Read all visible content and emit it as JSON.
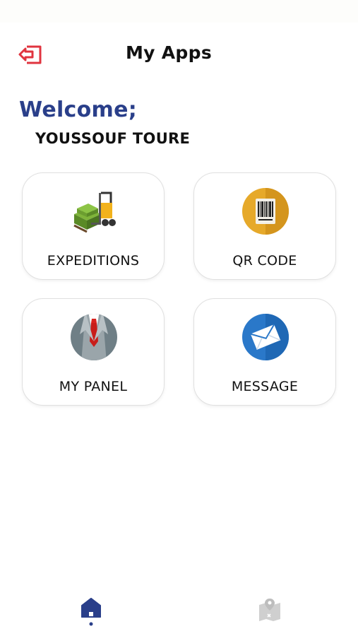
{
  "header": {
    "title": "My Apps",
    "logout_icon": "logout-icon",
    "logout_color": "#e0343f"
  },
  "greeting": {
    "welcome": "Welcome;",
    "user_name": "YOUSSOUF TOURE",
    "welcome_color": "#2a3f8a"
  },
  "apps": [
    {
      "label": "EXPEDITIONS",
      "icon": "forklift-icon"
    },
    {
      "label": "QR CODE",
      "icon": "barcode-icon"
    },
    {
      "label": "MY PANEL",
      "icon": "suit-icon"
    },
    {
      "label": "MESSAGE",
      "icon": "envelope-icon"
    }
  ],
  "bottom_nav": [
    {
      "icon": "home-icon",
      "active": true,
      "color": "#2a3f8a"
    },
    {
      "icon": "map-icon",
      "active": false,
      "color": "#cfcfcf"
    }
  ]
}
